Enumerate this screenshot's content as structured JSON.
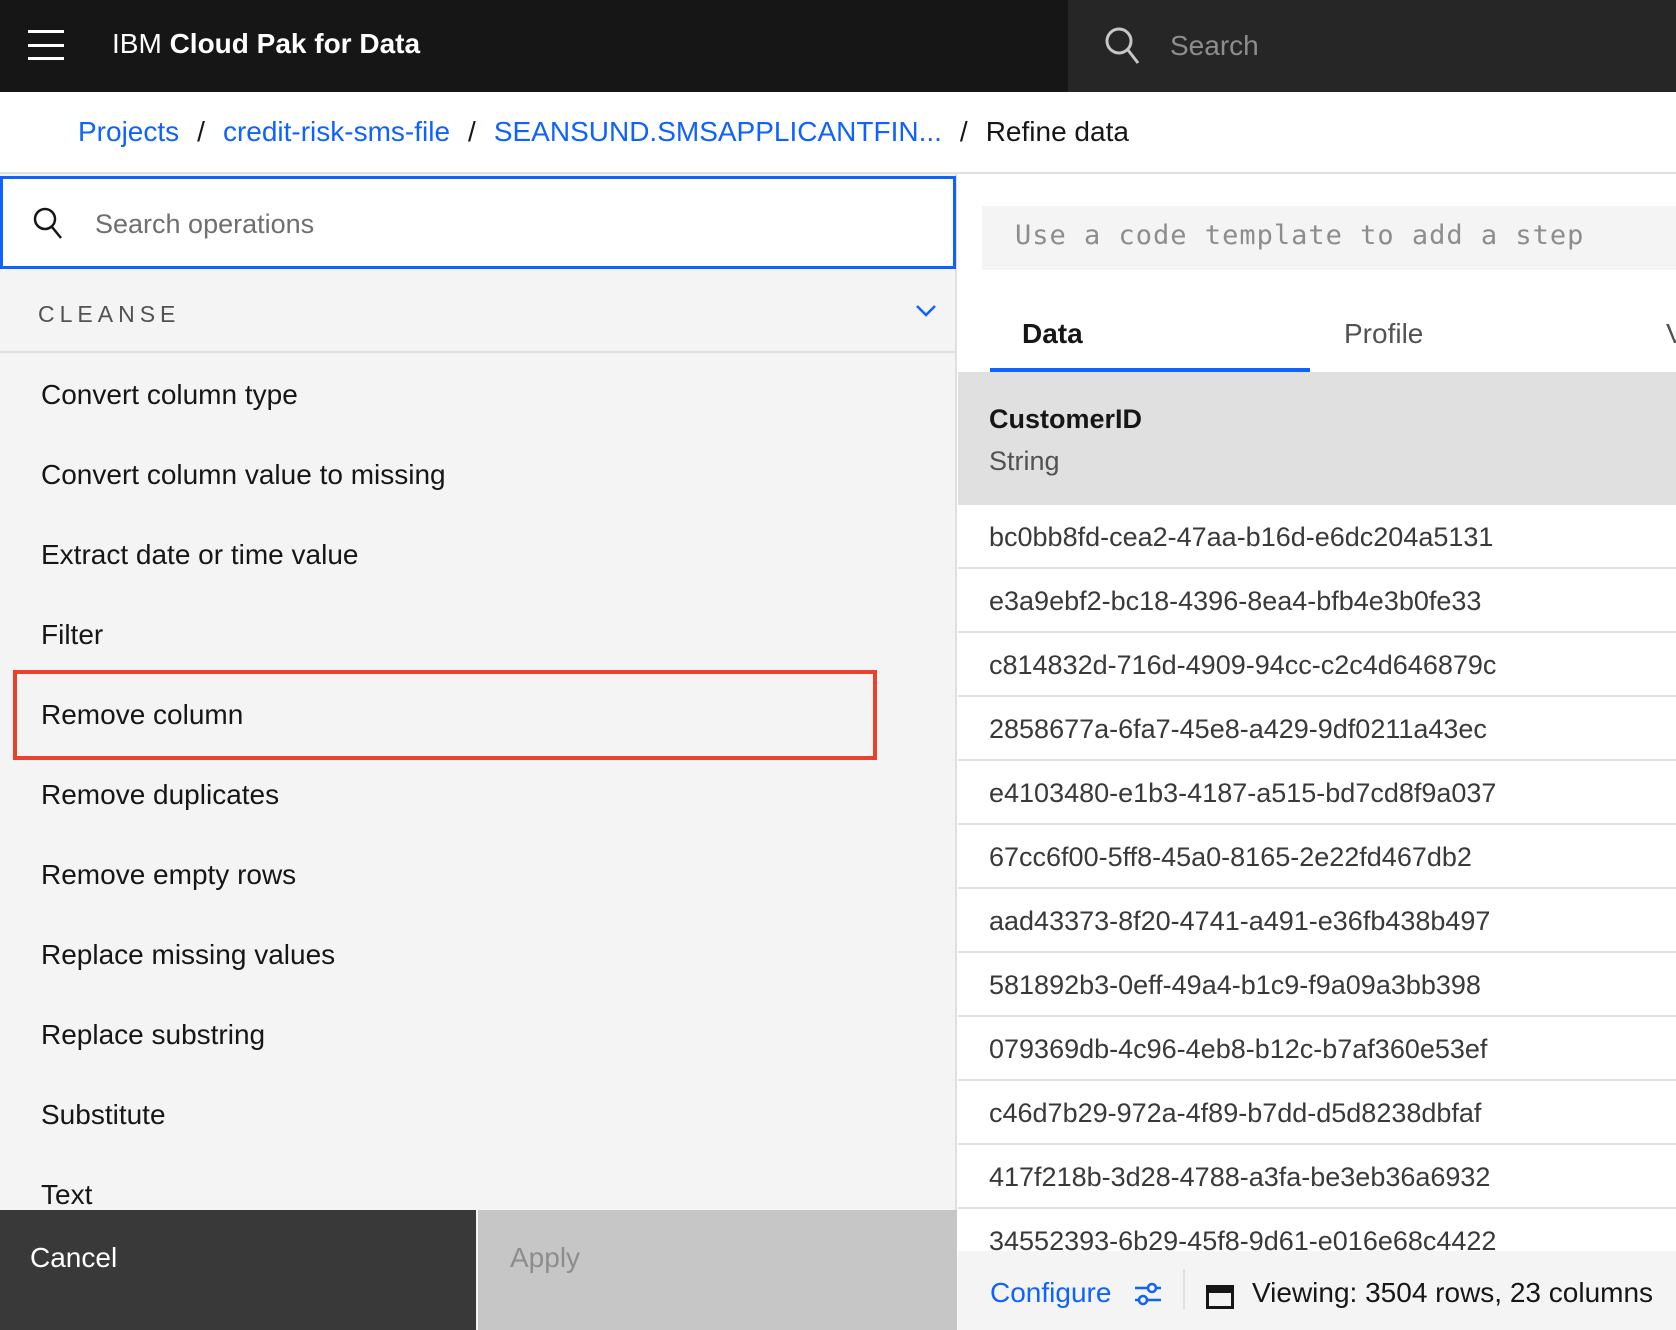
{
  "header": {
    "brand_prefix": "IBM",
    "brand_name": "Cloud Pak for Data",
    "search_placeholder": "Search"
  },
  "breadcrumb": {
    "items": [
      "Projects",
      "credit-risk-sms-file",
      "SEANSUND.SMSAPPLICANTFIN..."
    ],
    "current": "Refine data"
  },
  "operations": {
    "search_placeholder": "Search operations",
    "category": "CLEANSE",
    "items": [
      "Convert column type",
      "Convert column value to missing",
      "Extract date or time value",
      "Filter",
      "Remove column",
      "Remove duplicates",
      "Remove empty rows",
      "Replace missing values",
      "Replace substring",
      "Substitute",
      "Text"
    ],
    "highlighted": "Remove column",
    "cancel_label": "Cancel",
    "apply_label": "Apply"
  },
  "code_template_placeholder": "Use a code template to add a step",
  "tabs": [
    "Data",
    "Profile",
    "V"
  ],
  "active_tab": "Data",
  "column": {
    "name": "CustomerID",
    "type": "String"
  },
  "rows": [
    "bc0bb8fd-cea2-47aa-b16d-e6dc204a5131",
    "e3a9ebf2-bc18-4396-8ea4-bfb4e3b0fe33",
    "c814832d-716d-4909-94cc-c2c4d646879c",
    "2858677a-6fa7-45e8-a429-9df0211a43ec",
    "e4103480-e1b3-4187-a515-bd7cd8f9a037",
    "67cc6f00-5ff8-45a0-8165-2e22fd467db2",
    "aad43373-8f20-4741-a491-e36fb438b497",
    "581892b3-0eff-49a4-b1c9-f9a09a3bb398",
    "079369db-4c96-4eb8-b12c-b7af360e53ef",
    "c46d7b29-972a-4f89-b7dd-d5d8238dbfaf",
    "417f218b-3d28-4788-a3fa-be3eb36a6932",
    "34552393-6b29-45f8-9d61-e016e68c4422"
  ],
  "footer": {
    "configure_label": "Configure",
    "viewing": "Viewing:  3504 rows, 23 columns"
  },
  "colors": {
    "accent": "#0f62fe",
    "highlight": "#e8412c",
    "header_bg": "#161616"
  }
}
